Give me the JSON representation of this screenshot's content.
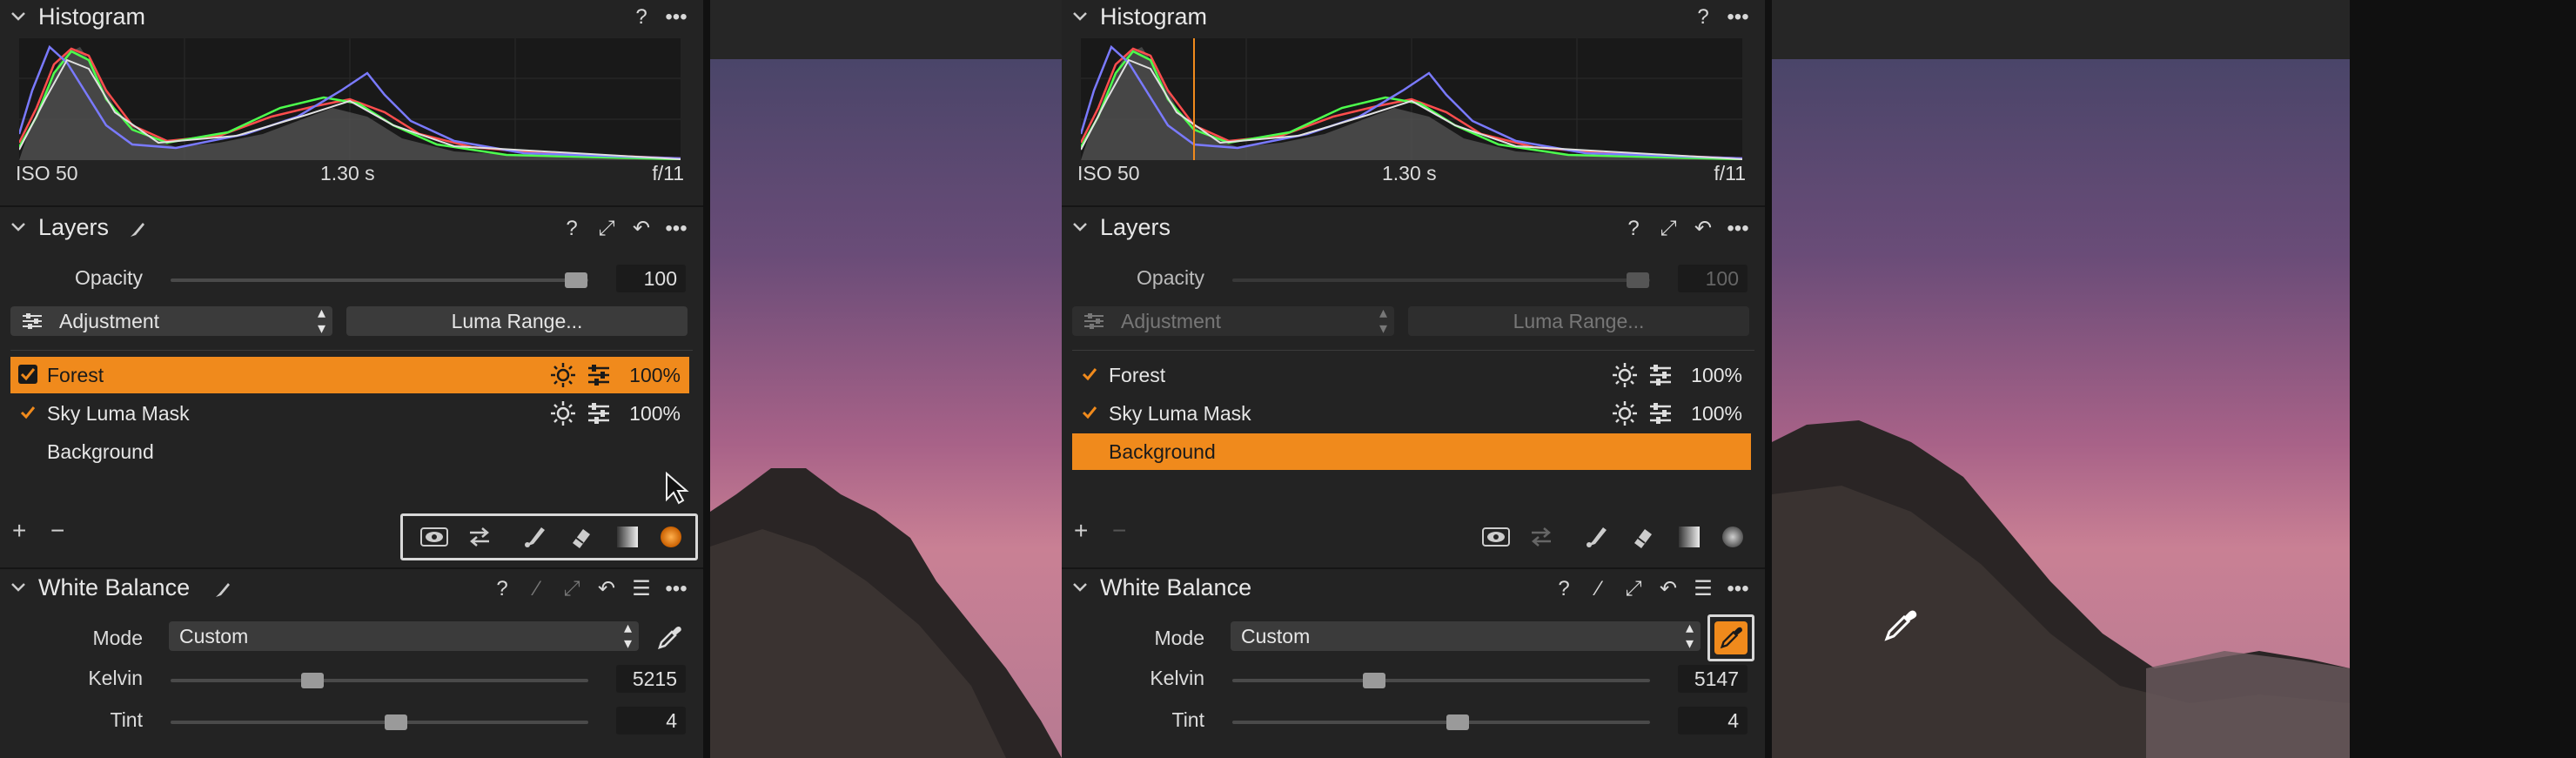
{
  "left": {
    "histogram": {
      "title": "Histogram",
      "iso": "ISO 50",
      "shutter": "1.30 s",
      "aperture": "f/11"
    },
    "layers": {
      "title": "Layers",
      "opacity_label": "Opacity",
      "opacity_value": "100",
      "opacity_level": 0.97,
      "mode_select": "Adjustment",
      "luma_button": "Luma Range...",
      "items": [
        {
          "name": "Forest",
          "checked": true,
          "pct": "100%",
          "selected": true
        },
        {
          "name": "Sky Luma Mask",
          "checked": true,
          "pct": "100%",
          "selected": false
        },
        {
          "name": "Background",
          "checked": false,
          "pct": "",
          "selected": false
        }
      ]
    },
    "white_balance": {
      "title": "White Balance",
      "mode_label": "Mode",
      "mode_value": "Custom",
      "kelvin_label": "Kelvin",
      "kelvin_value": "5215",
      "kelvin_level": 0.34,
      "tint_label": "Tint",
      "tint_value": "4",
      "tint_level": 0.54
    }
  },
  "right": {
    "histogram": {
      "title": "Histogram",
      "iso": "ISO 50",
      "shutter": "1.30 s",
      "aperture": "f/11"
    },
    "layers": {
      "title": "Layers",
      "opacity_label": "Opacity",
      "opacity_value": "100",
      "opacity_level": 0.97,
      "mode_select": "Adjustment",
      "luma_button": "Luma Range...",
      "items": [
        {
          "name": "Forest",
          "checked": true,
          "pct": "100%",
          "selected": false
        },
        {
          "name": "Sky Luma Mask",
          "checked": true,
          "pct": "100%",
          "selected": false
        },
        {
          "name": "Background",
          "checked": false,
          "pct": "",
          "selected": true
        }
      ]
    },
    "white_balance": {
      "title": "White Balance",
      "mode_label": "Mode",
      "mode_value": "Custom",
      "kelvin_label": "Kelvin",
      "kelvin_value": "5147",
      "kelvin_level": 0.34,
      "tint_label": "Tint",
      "tint_value": "4",
      "tint_level": 0.54
    }
  },
  "colors": {
    "accent": "#f08a1c",
    "panel": "#232323"
  }
}
